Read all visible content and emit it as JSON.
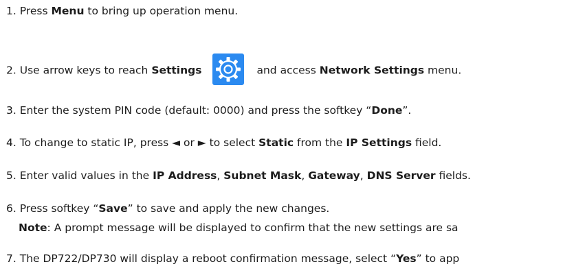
{
  "steps": [
    {
      "num": "1.",
      "pre": "Press ",
      "b1": "Menu",
      "post": " to bring up operation menu."
    },
    {
      "num": "2.",
      "pre": "Use arrow keys to reach ",
      "b1": "Settings",
      "icon": "settings-gear-icon",
      "mid": "and access ",
      "b2": "Network Settings",
      "post": " menu."
    },
    {
      "num": "3.",
      "pre": "Enter the system PIN code (default: 0000) and press the softkey “",
      "b1": "Done",
      "post": "”."
    },
    {
      "num": "4.",
      "pre": "To change to static IP, press ◄ or ► to select ",
      "b1": "Static",
      "mid": " from the ",
      "b2": "IP Settings",
      "post": " field."
    },
    {
      "num": "5.",
      "pre": "Enter valid values in the ",
      "b1": "IP Address",
      "s1": ", ",
      "b2": "Subnet Mask",
      "s2": ", ",
      "b3": "Gateway",
      "s3": ", ",
      "b4": "DNS Server",
      "post": " fields."
    },
    {
      "num": "6.",
      "pre": "Press softkey “",
      "b1": "Save",
      "post": "” to save and apply the new changes.",
      "note_label": "Note",
      "note_text": ": A prompt message will be displayed to confirm that the new settings are sa"
    },
    {
      "num": "7.",
      "pre": "The DP722/DP730 will display a reboot confirmation message, select “",
      "b1": "Yes",
      "post": "” to app"
    }
  ],
  "colors": {
    "text": "#1c1c1c",
    "icon_bg": "#2b8af0",
    "icon_fg": "#ffffff"
  }
}
